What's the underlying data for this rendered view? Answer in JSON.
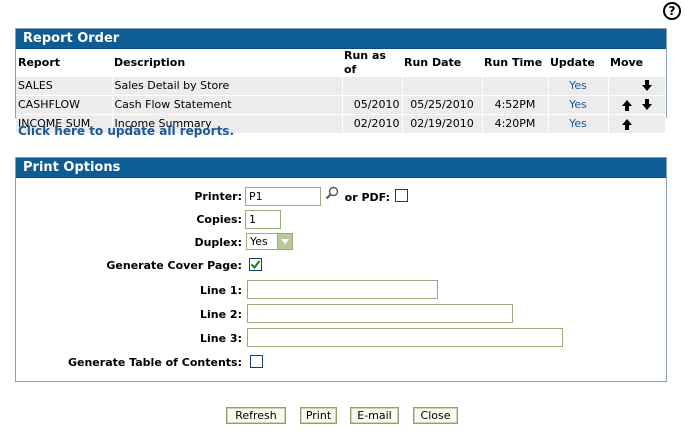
{
  "help": {
    "glyph": "?"
  },
  "report_panel": {
    "title": "Report Order",
    "columns": [
      "Report",
      "Description",
      "Run as of",
      "Run Date",
      "Run Time",
      "Update",
      "Move"
    ],
    "rows": [
      {
        "report": "SALES",
        "description": "Sales Detail by Store",
        "run_as_of": "",
        "run_date": "",
        "run_time": "",
        "update": "Yes",
        "move": [
          "down"
        ]
      },
      {
        "report": "CASHFLOW",
        "description": "Cash Flow Statement",
        "run_as_of": "05/2010",
        "run_date": "05/25/2010",
        "run_time": "4:52PM",
        "update": "Yes",
        "move": [
          "up",
          "down"
        ]
      },
      {
        "report": "INCOME SUM",
        "description": "Income Summary",
        "run_as_of": "02/2010",
        "run_date": "02/19/2010",
        "run_time": "4:20PM",
        "update": "Yes",
        "move": [
          "up"
        ]
      }
    ]
  },
  "update_all_link": "Click here to update all reports.",
  "print_panel": {
    "title": "Print Options",
    "printer_label": "Printer:",
    "printer_value": "P1",
    "or_pdf_label": "or PDF:",
    "or_pdf_checked": false,
    "copies_label": "Copies:",
    "copies_value": "1",
    "duplex_label": "Duplex:",
    "duplex_value": "Yes",
    "cover_label": "Generate Cover Page:",
    "cover_checked": true,
    "line1_label": "Line 1:",
    "line1_value": "",
    "line2_label": "Line 2:",
    "line2_value": "",
    "line3_label": "Line 3:",
    "line3_value": "",
    "toc_label": "Generate Table of Contents:",
    "toc_checked": false
  },
  "buttons": {
    "refresh": "Refresh",
    "print": "Print",
    "email": "E-mail",
    "close": "Close"
  },
  "colors": {
    "header_bg": "#0e5c94",
    "link": "#1a5a9a",
    "row_bg": "#ececec",
    "check": "#1a7a1a"
  }
}
